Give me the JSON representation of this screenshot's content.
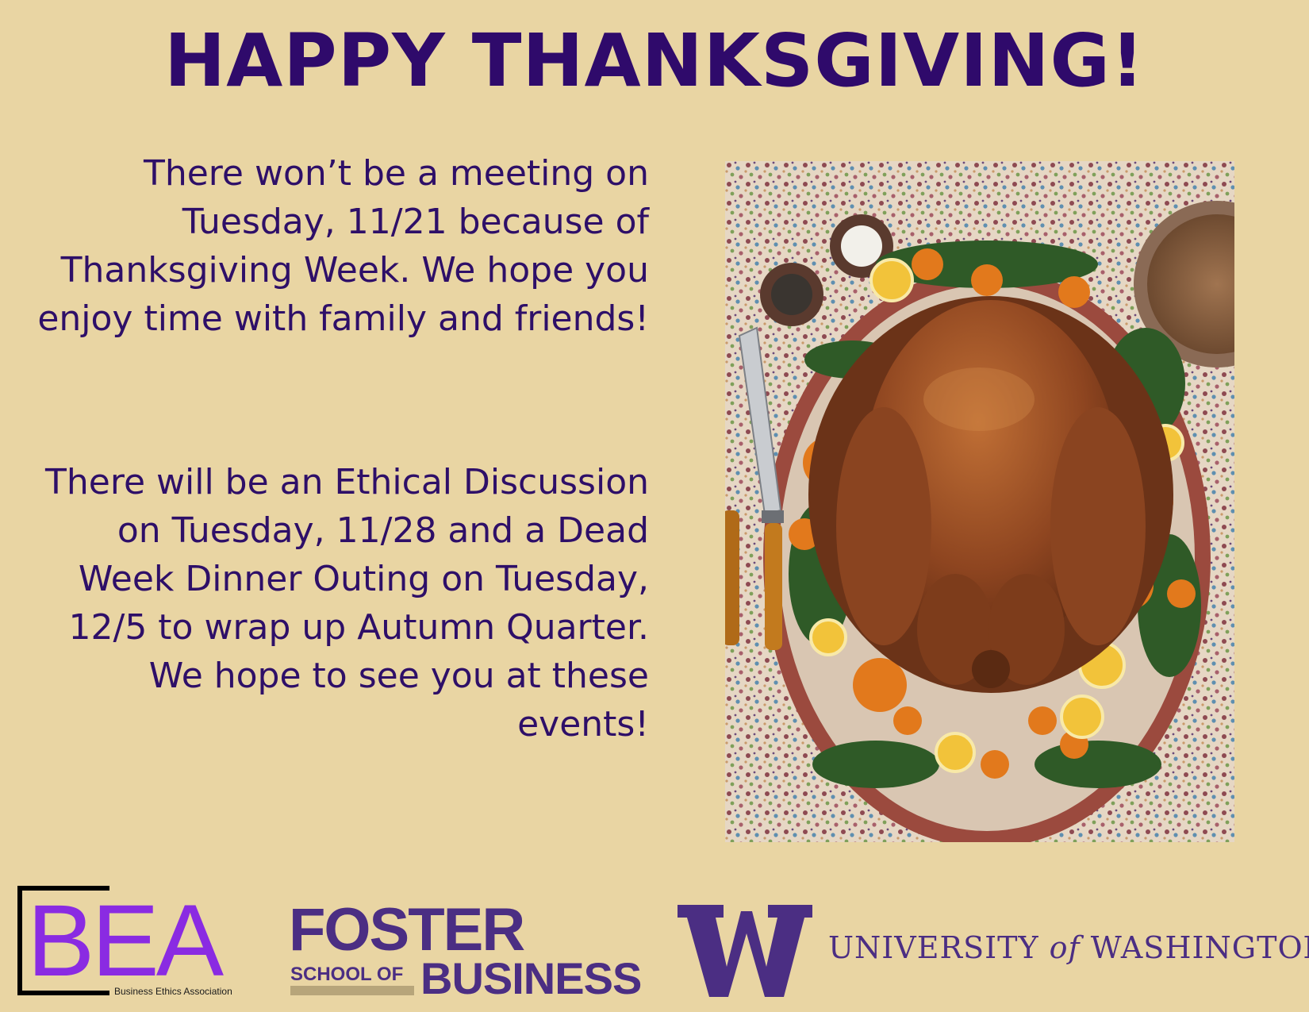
{
  "heading": "HAPPY THANKSGIVING!",
  "paragraphs": [
    "There won’t be a meeting on Tuesday, 11/21 because of Thanksgiving Week. We hope you enjoy time with family and friends!",
    "There will be an Ethical Discussion on Tuesday, 11/28 and a Dead Week Dinner Outing on Tuesday, 12/5 to wrap up Autumn Quarter. We hope to see you at these events!"
  ],
  "logos": {
    "bea": {
      "letters": "BEA",
      "subtitle": "Business Ethics Association"
    },
    "foster": {
      "top": "FOSTER",
      "school_of": "SCHOOL OF",
      "business": "BUSINESS"
    },
    "uw": {
      "part1": "UNIVERSITY",
      "of": "of",
      "part2": "WASHINGTON"
    }
  },
  "colors": {
    "background": "#e9d5a3",
    "text_purple": "#2e0f68",
    "uw_purple": "#4b2e83",
    "bea_violet": "#8a2be2",
    "uw_gold": "#b7a57a"
  }
}
